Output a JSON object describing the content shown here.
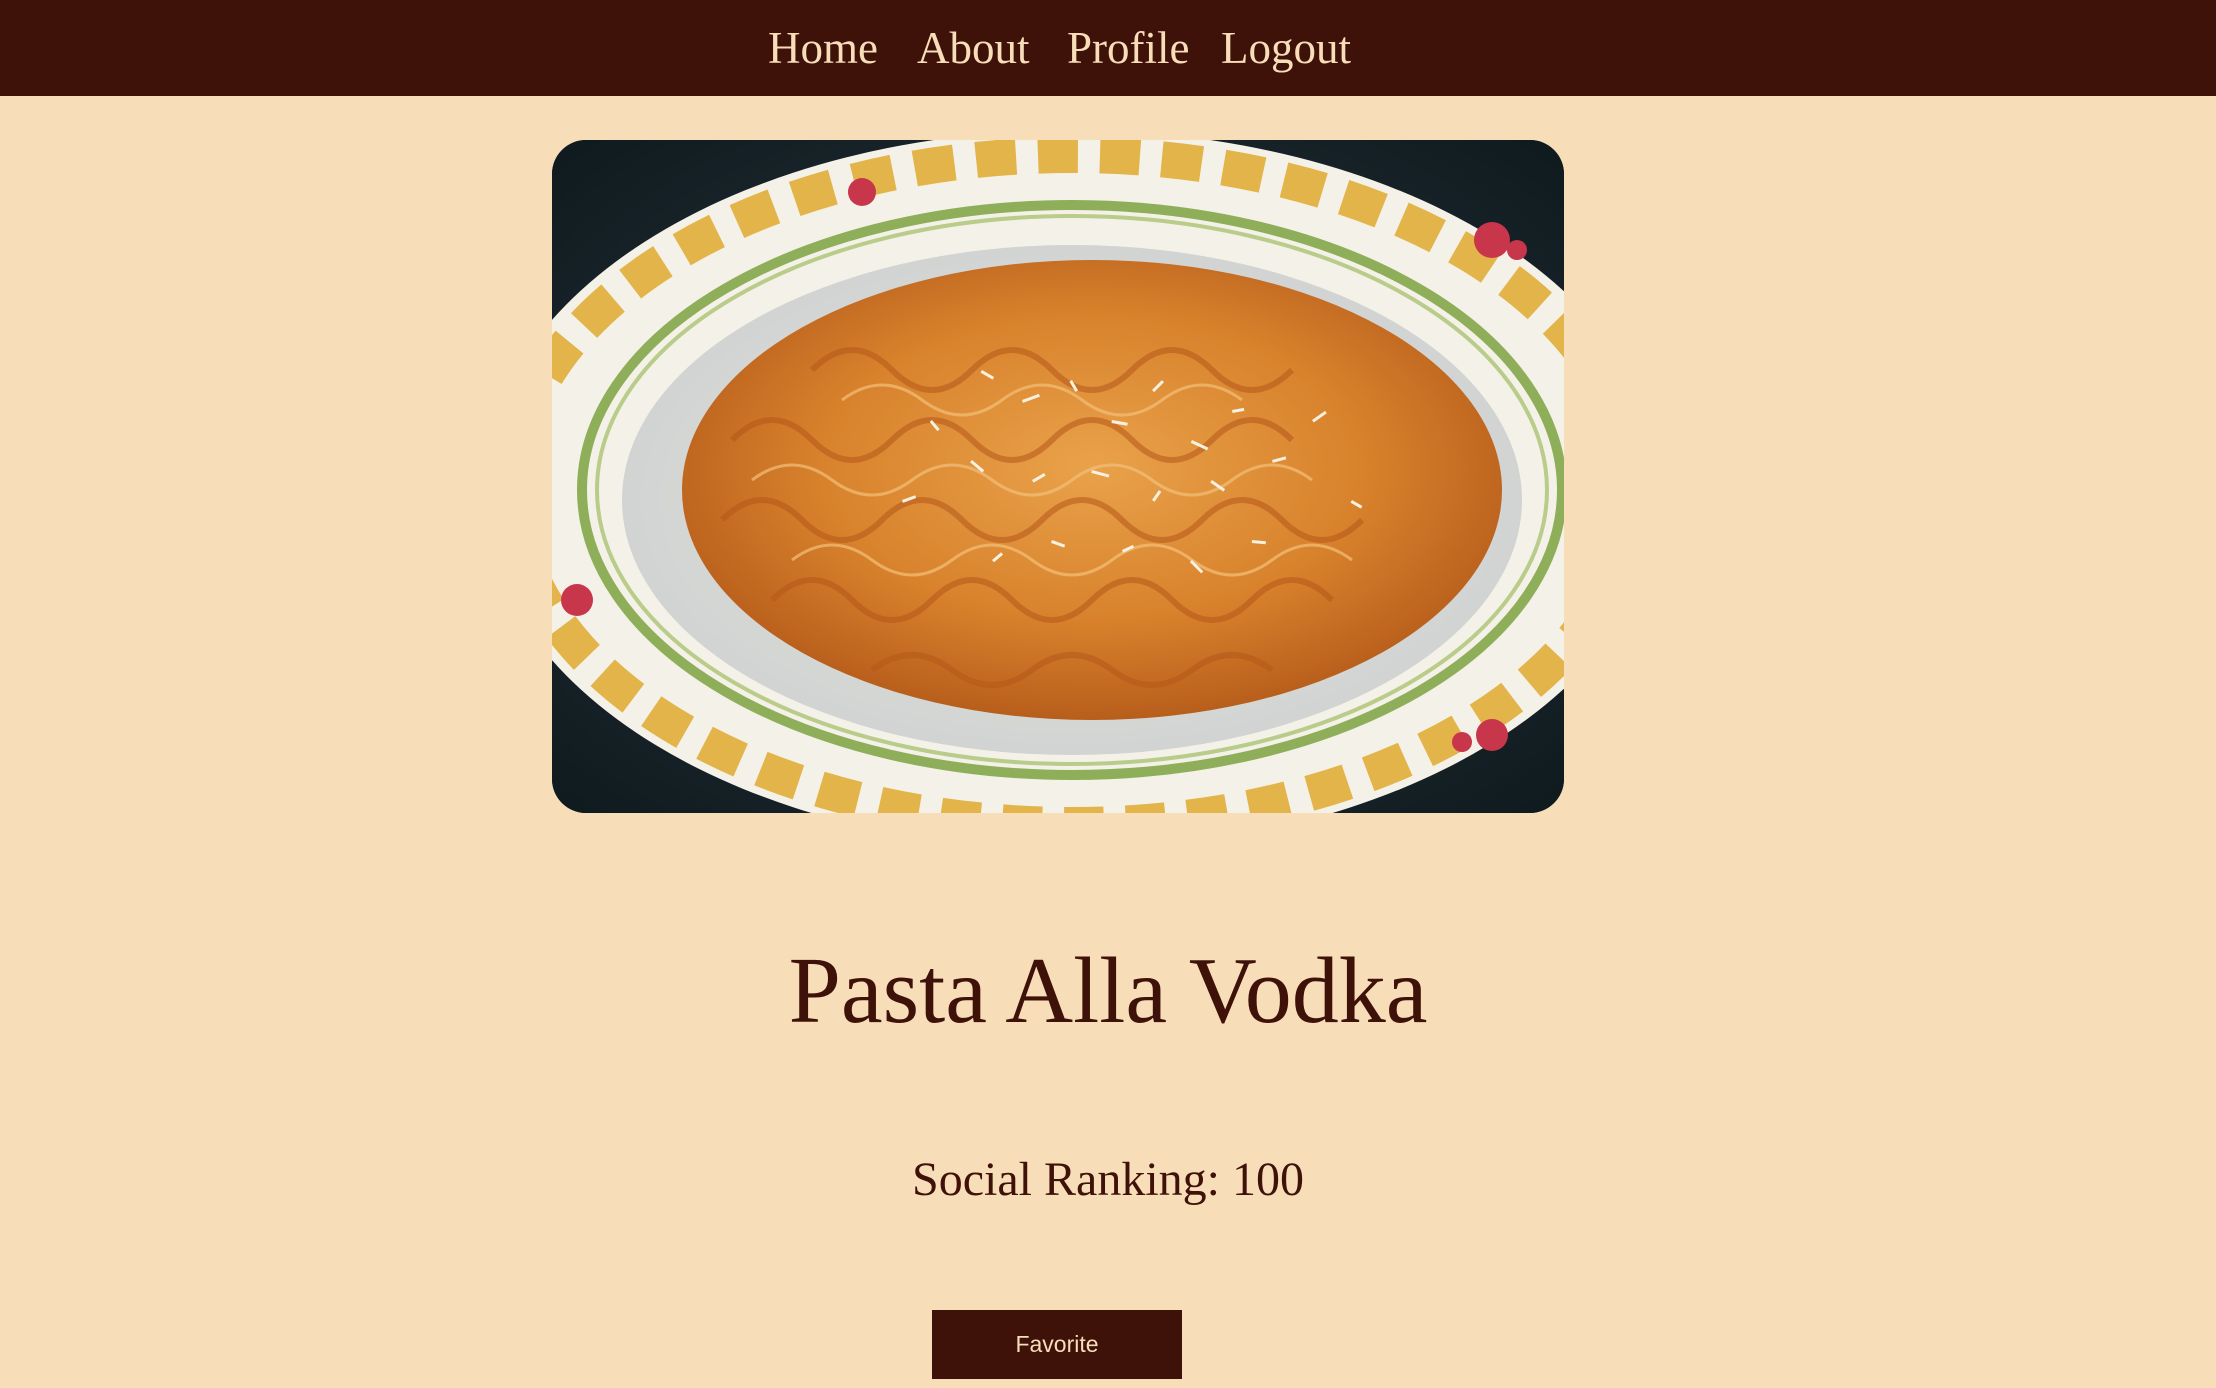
{
  "nav": {
    "items": [
      {
        "label": "Home"
      },
      {
        "label": "About"
      },
      {
        "label": "Profile"
      },
      {
        "label": "Logout"
      }
    ]
  },
  "recipe": {
    "title": "Pasta Alla Vodka",
    "ranking_label": "Social Ranking: 100",
    "favorite_label": "Favorite"
  },
  "colors": {
    "page_bg": "#f8ddb9",
    "brand_dark": "#3f1209",
    "nav_text": "#f8ddb9"
  }
}
